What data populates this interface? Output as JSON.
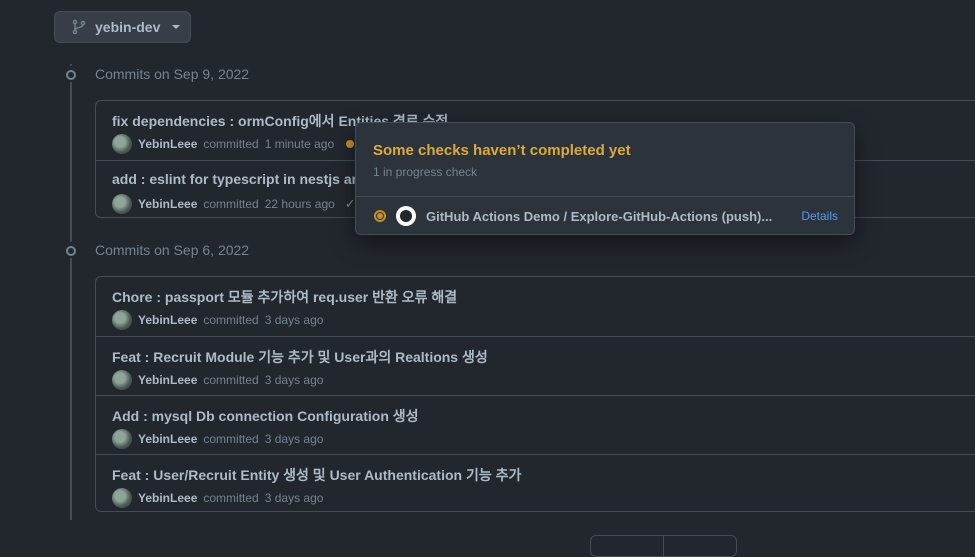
{
  "branch": {
    "name": "yebin-dev"
  },
  "groups": [
    {
      "heading": "Commits on Sep 9, 2022",
      "commits": [
        {
          "title": "fix dependencies : ormConfig에서 Entities 경로 수정",
          "author": "YebinLeee",
          "verb": "committed",
          "time": "1 minute ago",
          "status": "pending"
        },
        {
          "title": "add : eslint for typescript in nestjs and",
          "author": "YebinLeee",
          "verb": "committed",
          "time": "22 hours ago",
          "status": "success"
        }
      ]
    },
    {
      "heading": "Commits on Sep 6, 2022",
      "commits": [
        {
          "title": "Chore : passport 모듈 추가하여 req.user 반환 오류 해결",
          "author": "YebinLeee",
          "verb": "committed",
          "time": "3 days ago"
        },
        {
          "title": "Feat : Recruit Module 기능 추가 및 User과의 Realtions 생성",
          "author": "YebinLeee",
          "verb": "committed",
          "time": "3 days ago"
        },
        {
          "title": "Add : mysql Db connection Configuration 생성",
          "author": "YebinLeee",
          "verb": "committed",
          "time": "3 days ago"
        },
        {
          "title": "Feat : User/Recruit Entity 생성 및 User Authentication 기능 추가",
          "author": "YebinLeee",
          "verb": "committed",
          "time": "3 days ago"
        }
      ]
    }
  ],
  "popover": {
    "title": "Some checks haven’t completed yet",
    "subtitle": "1 in progress check",
    "check_name": "GitHub Actions Demo / Explore-GitHub-Actions (push)...",
    "details": "Details"
  },
  "colors": {
    "pending": "#c69026",
    "success": "#57ab5a",
    "link": "#539bf5"
  },
  "icons": {
    "branch": "git-branch-icon",
    "commit": "git-commit-icon",
    "in_progress": "in-progress-icon",
    "github": "github-logo-icon",
    "success": "check-icon",
    "pending": "pending-dot-icon"
  }
}
